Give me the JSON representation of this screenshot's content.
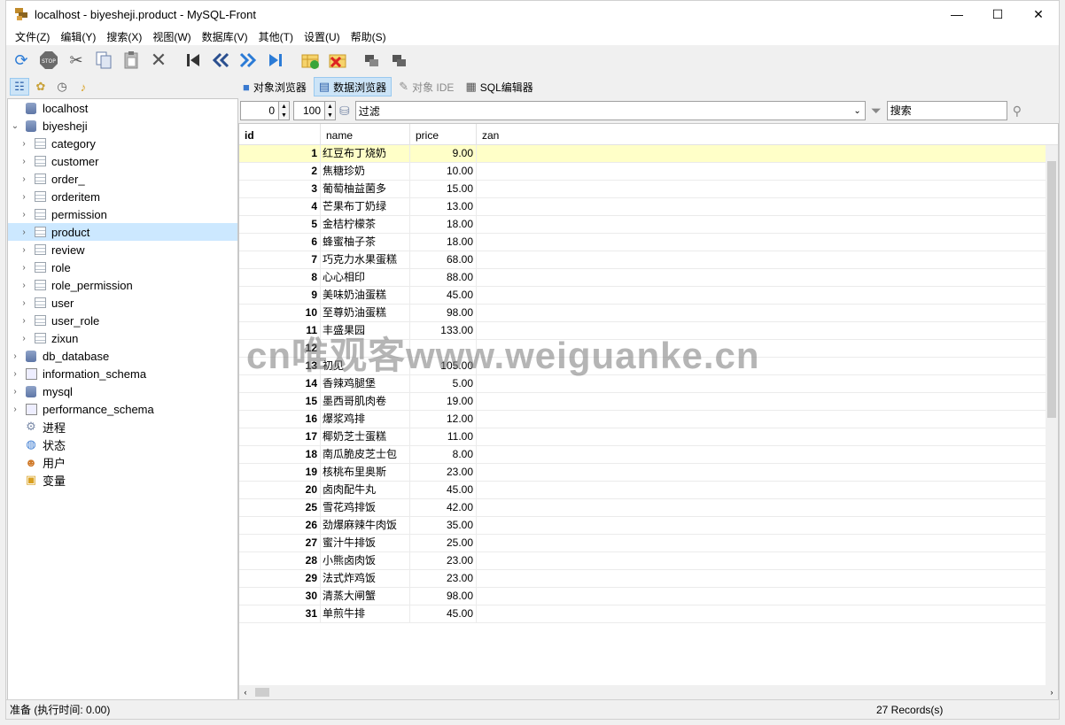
{
  "window": {
    "title": "localhost - biyesheji.product - MySQL-Front",
    "controls": {
      "minimize": "—",
      "maximize": "☐",
      "close": "✕"
    }
  },
  "menu": [
    "文件(Z)",
    "编辑(Y)",
    "搜索(X)",
    "视图(W)",
    "数据库(V)",
    "其他(T)",
    "设置(U)",
    "帮助(S)"
  ],
  "toolbar": {
    "icons": [
      "refresh-icon",
      "stop-icon",
      "cut-icon",
      "copy-icon",
      "paste-icon",
      "delete-icon",
      "first-record-icon",
      "prev-page-icon",
      "next-page-icon",
      "last-record-icon",
      "insert-row-icon",
      "delete-row-icon",
      "post-icon",
      "cancel-icon"
    ],
    "stop_label": "STOP"
  },
  "view_tabs": [
    {
      "label": "对象浏览器",
      "icon": "object-browser-icon",
      "active": false,
      "disabled": false
    },
    {
      "label": "数据浏览器",
      "icon": "data-browser-icon",
      "active": true,
      "disabled": false
    },
    {
      "label": "对象 IDE",
      "icon": "object-ide-icon",
      "active": false,
      "disabled": true
    },
    {
      "label": "SQL编辑器",
      "icon": "sql-editor-icon",
      "active": false,
      "disabled": false
    }
  ],
  "filterbar": {
    "offset": "0",
    "limit": "100",
    "filter_placeholder": "过滤",
    "search_placeholder": "搜索"
  },
  "tree": {
    "root": "localhost",
    "database": "biyesheji",
    "tables": [
      "category",
      "customer",
      "order_",
      "orderitem",
      "permission",
      "product",
      "review",
      "role",
      "role_permission",
      "user",
      "user_role",
      "zixun"
    ],
    "selected_table": "product",
    "other_databases": [
      "db_database",
      "information_schema",
      "mysql",
      "performance_schema"
    ],
    "tools": [
      {
        "label": "进程",
        "icon": "process-icon"
      },
      {
        "label": "状态",
        "icon": "status-icon"
      },
      {
        "label": "用户",
        "icon": "users-icon"
      },
      {
        "label": "变量",
        "icon": "variables-icon"
      }
    ]
  },
  "grid": {
    "columns": [
      "id",
      "name",
      "price",
      "zan"
    ],
    "rows": [
      [
        "1",
        "红豆布丁烧奶",
        "9.00"
      ],
      [
        "2",
        "焦糖珍奶",
        "10.00"
      ],
      [
        "3",
        "葡萄柚益菌多",
        "15.00"
      ],
      [
        "4",
        "芒果布丁奶绿",
        "13.00"
      ],
      [
        "5",
        "金桔柠檬茶",
        "18.00"
      ],
      [
        "6",
        "蜂蜜柚子茶",
        "18.00"
      ],
      [
        "7",
        "巧克力水果蛋糕",
        "68.00"
      ],
      [
        "8",
        "心心相印",
        "88.00"
      ],
      [
        "9",
        "美味奶油蛋糕",
        "45.00"
      ],
      [
        "10",
        "至尊奶油蛋糕",
        "98.00"
      ],
      [
        "11",
        "丰盛果园",
        "133.00"
      ],
      [
        "12",
        "",
        ""
      ],
      [
        "13",
        "初见",
        "105.00"
      ],
      [
        "14",
        "香辣鸡腿堡",
        "5.00"
      ],
      [
        "15",
        "墨西哥肌肉卷",
        "19.00"
      ],
      [
        "16",
        "爆浆鸡排",
        "12.00"
      ],
      [
        "17",
        "椰奶芝士蛋糕",
        "11.00"
      ],
      [
        "18",
        "南瓜脆皮芝士包",
        "8.00"
      ],
      [
        "19",
        "核桃布里奥斯",
        "23.00"
      ],
      [
        "20",
        "卤肉配牛丸",
        "45.00"
      ],
      [
        "25",
        "雪花鸡排饭",
        "42.00"
      ],
      [
        "26",
        "劲爆麻辣牛肉饭",
        "35.00"
      ],
      [
        "27",
        "蜜汁牛排饭",
        "25.00"
      ],
      [
        "28",
        "小熊卤肉饭",
        "23.00"
      ],
      [
        "29",
        "法式炸鸡饭",
        "23.00"
      ],
      [
        "30",
        "清蒸大闸蟹",
        "98.00"
      ],
      [
        "31",
        "单煎牛排",
        "45.00"
      ]
    ],
    "highlighted_row": 0
  },
  "status": {
    "left": "准备  (执行时间: 0.00)",
    "records": "27 Records(s)"
  },
  "watermark": "cn唯观客www.weiguanke.cn"
}
